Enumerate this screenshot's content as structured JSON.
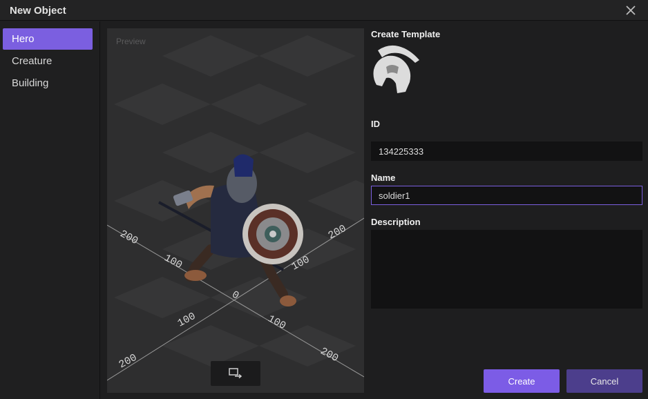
{
  "window": {
    "title": "New Object"
  },
  "sidebar": {
    "items": [
      {
        "label": "Hero",
        "active": true
      },
      {
        "label": "Creature",
        "active": false
      },
      {
        "label": "Building",
        "active": false
      }
    ]
  },
  "preview": {
    "label": "Preview",
    "axis_labels": [
      "200",
      "100",
      "0",
      "100",
      "200",
      "200",
      "100",
      "200",
      "100"
    ]
  },
  "form": {
    "template_label": "Create Template",
    "id_label": "ID",
    "id_value": "134225333",
    "name_label": "Name",
    "name_value": "soldier1",
    "description_label": "Description",
    "description_value": ""
  },
  "buttons": {
    "create": "Create",
    "cancel": "Cancel"
  },
  "colors": {
    "accent": "#7b5fe0",
    "cancel": "#4c3e8c",
    "background": "#1e1e1f"
  },
  "icons": {
    "close": "close-icon",
    "toggle": "switch-view-icon",
    "template": "spartan-helmet-icon"
  }
}
